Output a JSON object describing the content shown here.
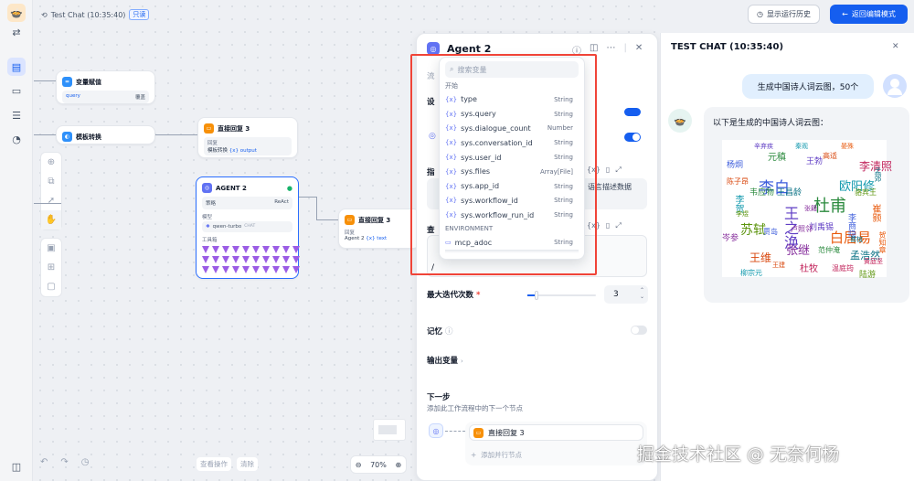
{
  "app": {
    "title": "Test Chat (10:35:40)",
    "readonly_badge": "只读"
  },
  "topbar": {
    "history_btn": "显示运行历史",
    "back_btn": "返回编辑模式"
  },
  "nodes": {
    "var_assign": {
      "title": "变量赋值",
      "field": "query",
      "tag": "覆盖"
    },
    "template": {
      "title": "模板转换"
    },
    "reply3_top": {
      "title": "直接回复 3",
      "label": "回复",
      "src": "模板转换",
      "var": "{x} output"
    },
    "agent": {
      "title": "AGENT 2",
      "strategy_label": "策略",
      "strategy_value": "ReAct",
      "model_label": "模型",
      "model_name": "qwen-turbo",
      "model_tag": "CHAT",
      "tools_label": "工具箱"
    },
    "reply3_mid": {
      "title": "直接回复 3",
      "label": "回复",
      "src": "Agent 2",
      "var": "{x} text"
    }
  },
  "bottom": {
    "view_op": "查看操作",
    "clear": "清除",
    "zoom": "70%"
  },
  "panel": {
    "title": "Agent 2",
    "iter_label": "最大迭代次数",
    "iter_value": "3",
    "memory_label": "记忆",
    "output_label": "输出变量",
    "next_label": "下一步",
    "next_desc": "添加此工作流程中的下一个节点",
    "next_node": "直接回复 3",
    "add_parallel": "添加并行节点",
    "hidden_text": "语言描述数据",
    "partial_left": [
      "流",
      "设",
      "指",
      "查"
    ]
  },
  "dropdown": {
    "search_placeholder": "搜索变量",
    "section_start": "开始",
    "items": [
      {
        "name": "type",
        "type": "String"
      },
      {
        "name": "sys.query",
        "type": "String"
      },
      {
        "name": "sys.dialogue_count",
        "type": "Number"
      },
      {
        "name": "sys.conversation_id",
        "type": "String"
      },
      {
        "name": "sys.user_id",
        "type": "String"
      },
      {
        "name": "sys.files",
        "type": "Array[File]"
      },
      {
        "name": "sys.app_id",
        "type": "String"
      },
      {
        "name": "sys.workflow_id",
        "type": "String"
      },
      {
        "name": "sys.workflow_run_id",
        "type": "String"
      }
    ],
    "section_env": "ENVIRONMENT",
    "env_items": [
      {
        "name": "mcp_adoc",
        "type": "String"
      }
    ]
  },
  "chat": {
    "title": "TEST CHAT (10:35:40)",
    "user_msg": "生成中国诗人词云图，50个",
    "bot_msg": "以下是生成的中国诗人词云图：",
    "cloud_words": [
      "李白",
      "杜甫",
      "王之涣",
      "白居易",
      "欧阳修",
      "李清照",
      "苏轼",
      "张继",
      "王维",
      "孟浩然",
      "杨炯",
      "元稹",
      "王勃",
      "崔颢",
      "李贺",
      "杜牧",
      "陆游",
      "岑参",
      "高适",
      "王昌龄",
      "李商隐",
      "韦应物",
      "刘禹锡",
      "贺知章",
      "柳宗元",
      "温庭筠",
      "骆宾王",
      "卢照邻",
      "陈子昂",
      "孟郊",
      "贾岛",
      "范仲淹",
      "辛弃疾",
      "晏殊",
      "秦观",
      "黄庭坚",
      "李煜",
      "张籍",
      "王建",
      "曹植"
    ]
  },
  "watermark": "掘金技术社区 @ 无奈何杨"
}
